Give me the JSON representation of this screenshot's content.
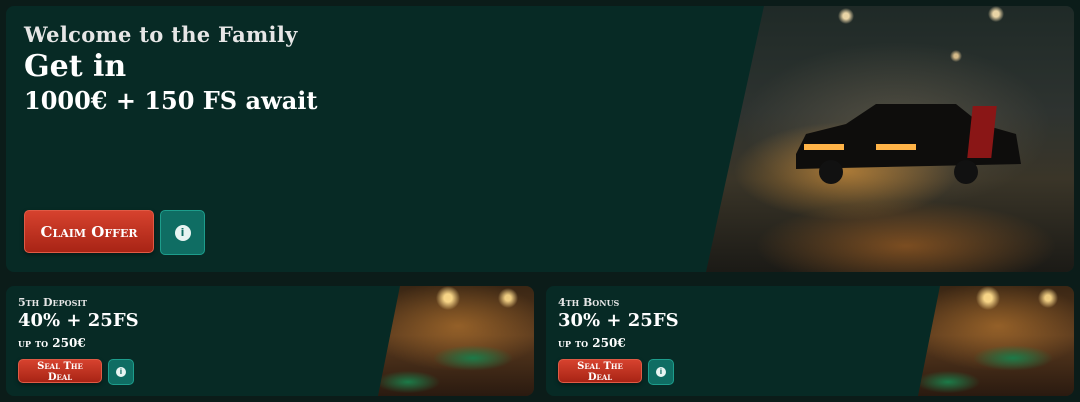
{
  "hero": {
    "eyebrow": "Welcome to the Family",
    "title": "Get in",
    "subtitle": "1000€ + 150 FS await",
    "cta_label": "Claim Offer",
    "info_icon": "info-icon"
  },
  "cards": [
    {
      "eyebrow": "5th Deposit",
      "title": "40% + 25FS",
      "subtitle": "up to 250€",
      "cta_label": "Seal The Deal",
      "info_icon": "info-icon"
    },
    {
      "eyebrow": "4th Bonus",
      "title": "30% + 25FS",
      "subtitle": "up to 250€",
      "cta_label": "Seal The Deal",
      "info_icon": "info-icon"
    }
  ],
  "colors": {
    "background": "#0b1c19",
    "panel": "#072a25",
    "cta": "#c0321f",
    "info_button": "#0f6d63"
  }
}
